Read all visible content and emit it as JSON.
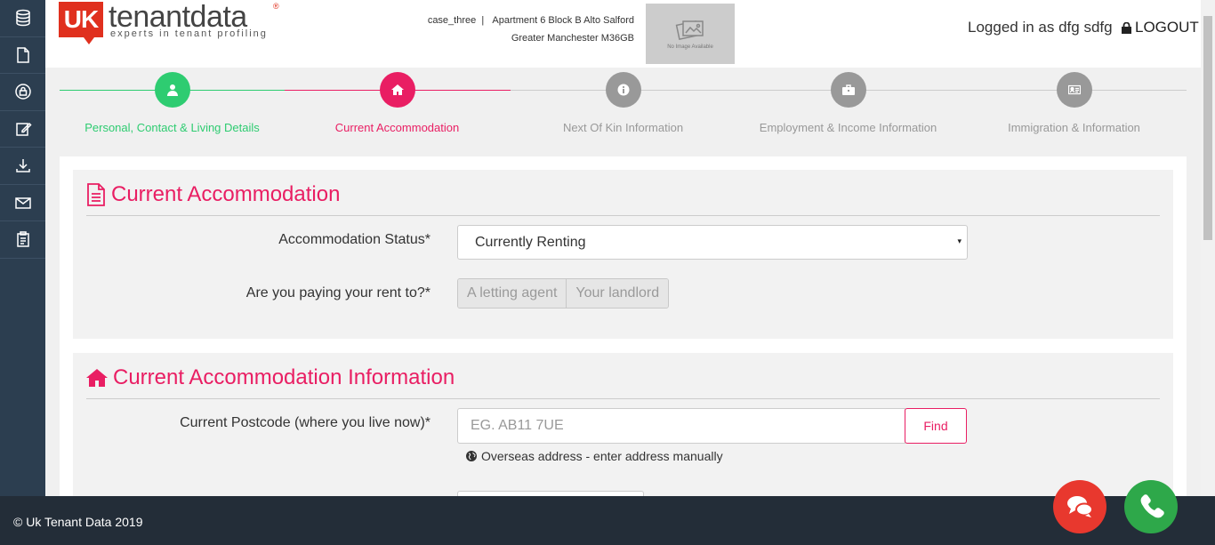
{
  "header": {
    "logo_mark": "UK",
    "logo_brand": "tenantdata",
    "logo_reg": "®",
    "logo_tagline": "experts in tenant profiling",
    "case_name": "case_three",
    "separator": "|",
    "address_line1": "Apartment 6 Block B Alto Salford",
    "address_line2": "Greater Manchester M36GB",
    "no_image_text": "No Image Available",
    "logged_in": "Logged in as dfg sdfg",
    "logout": "LOGOUT"
  },
  "sidebar": {
    "items": [
      {
        "icon": "database-icon"
      },
      {
        "icon": "document-icon"
      },
      {
        "icon": "lock-circle-icon"
      },
      {
        "icon": "edit-icon"
      },
      {
        "icon": "download-icon"
      },
      {
        "icon": "envelope-icon"
      },
      {
        "icon": "clipboard-icon"
      }
    ]
  },
  "steps": [
    {
      "label": "Personal, Contact & Living Details",
      "state": "complete",
      "color": "#2ecc71",
      "icon": "user-icon"
    },
    {
      "label": "Current Accommodation",
      "state": "active",
      "color": "#e91e63",
      "icon": "home-icon"
    },
    {
      "label": "Next Of Kin Information",
      "state": "pending",
      "color": "#999999",
      "icon": "info-icon"
    },
    {
      "label": "Employment & Income Information",
      "state": "pending",
      "color": "#999999",
      "icon": "briefcase-icon"
    },
    {
      "label": "Immigration & Information",
      "state": "pending",
      "color": "#999999",
      "icon": "id-card-icon"
    }
  ],
  "accommodation": {
    "title": "Current Accommodation",
    "status_label": "Accommodation Status*",
    "status_value": "Currently Renting",
    "caret": "▾",
    "paying_label": "Are you paying your rent to?*",
    "paying_options": [
      "A letting agent",
      "Your landlord"
    ]
  },
  "accommodation_info": {
    "title": "Current Accommodation Information",
    "postcode_label": "Current Postcode (where you live now)*",
    "postcode_placeholder": "EG. AB11 7UE",
    "find_label": "Find",
    "overseas_link": "Overseas address - enter address manually"
  },
  "footer": {
    "copyright": "© Uk Tenant Data 2019"
  },
  "colors": {
    "accent": "#e91e63",
    "success": "#2ecc71",
    "sidebar": "#2c3e50",
    "footer": "#232d38",
    "chat_fab": "#e8382e",
    "phone_fab": "#2ea84a"
  }
}
